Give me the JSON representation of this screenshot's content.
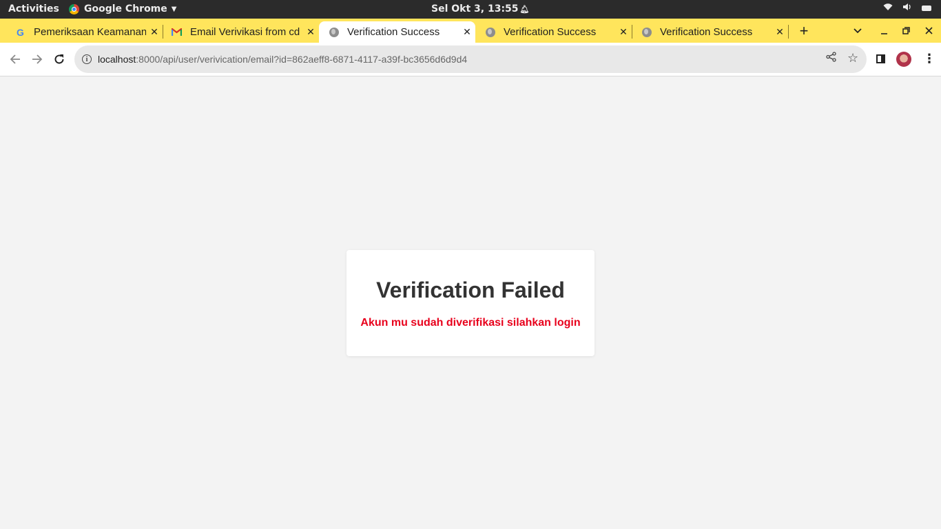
{
  "system_bar": {
    "activities": "Activities",
    "app_name": "Google Chrome",
    "clock": "Sel Okt  3, 13:55"
  },
  "tabs": [
    {
      "title": "Pemeriksaan Keamanan",
      "icon": "google-g-icon",
      "active": false
    },
    {
      "title": "Email Verivikasi from cd",
      "icon": "gmail-icon",
      "active": false
    },
    {
      "title": "Verification Success",
      "icon": "globe-icon",
      "active": true
    },
    {
      "title": "Verification Success",
      "icon": "globe-icon",
      "active": false
    },
    {
      "title": "Verification Success",
      "icon": "globe-icon",
      "active": false
    }
  ],
  "toolbar": {
    "url_host": "localhost",
    "url_rest": ":8000/api/user/verivication/email?id=862aeff8-6871-4117-a39f-bc3656d6d9d4"
  },
  "page": {
    "heading": "Verification Failed",
    "message": "Akun mu sudah diverifikasi silahkan login"
  },
  "colors": {
    "tab_strip": "#ffe55c",
    "error_text": "#e8001c",
    "page_bg": "#f3f3f3"
  }
}
